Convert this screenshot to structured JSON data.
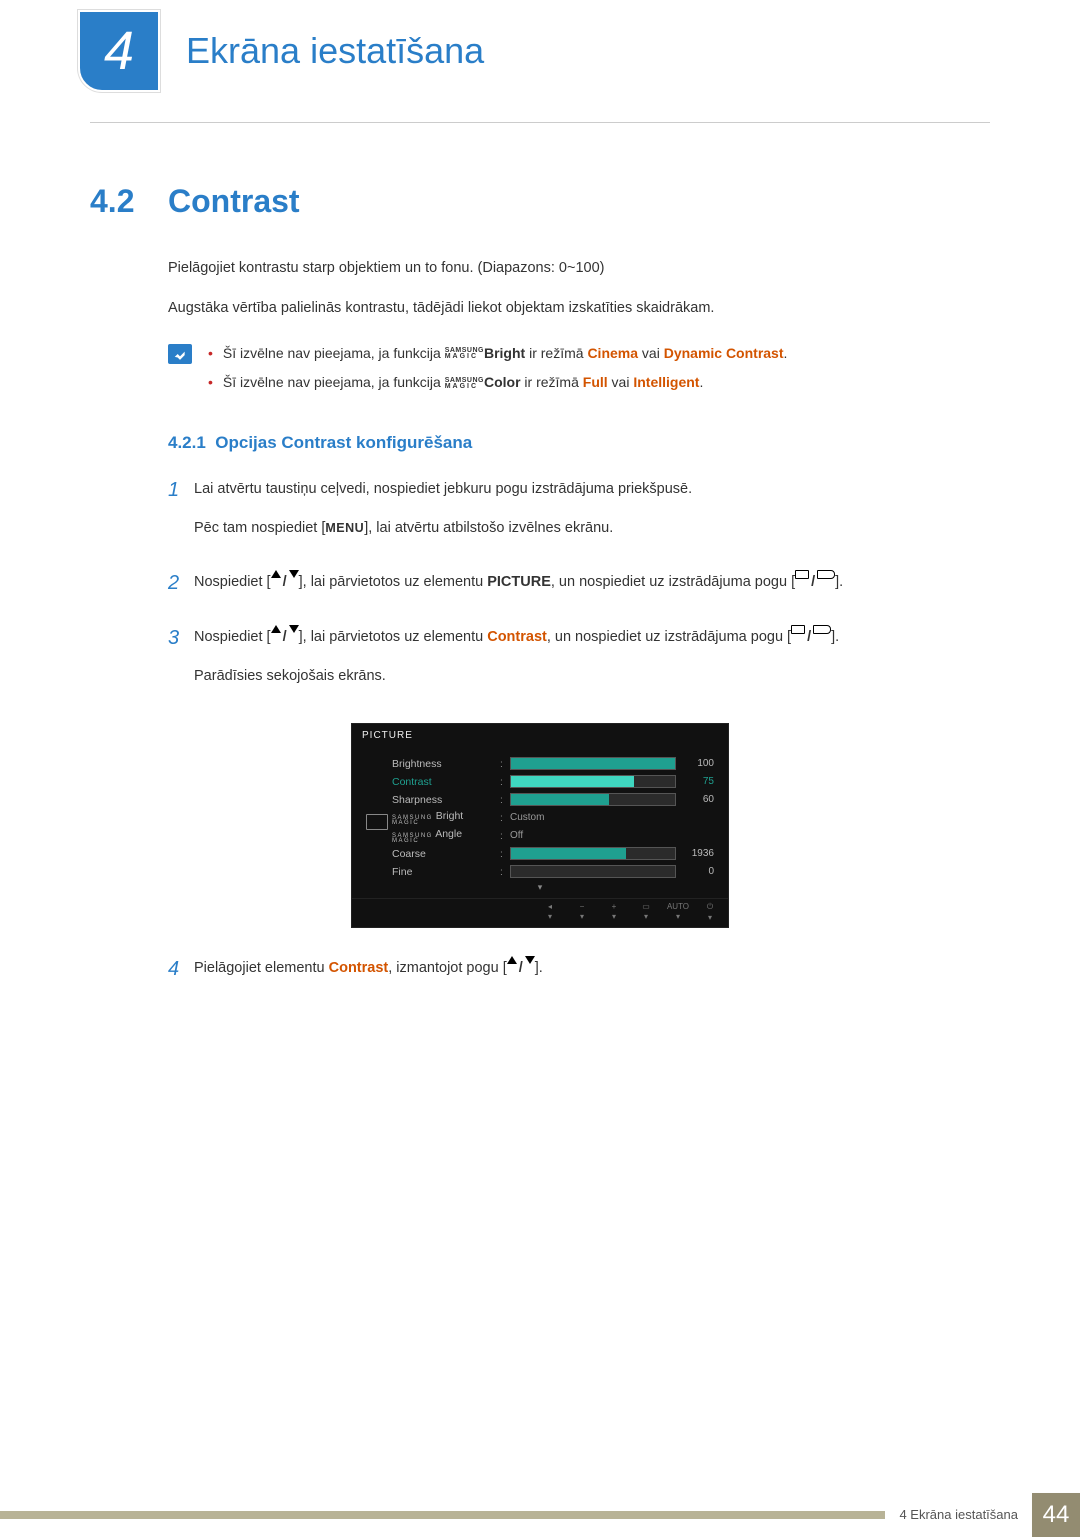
{
  "header": {
    "chapter_number": "4",
    "chapter_title": "Ekrāna iestatīšana"
  },
  "section": {
    "number": "4.2",
    "title": "Contrast"
  },
  "intro": {
    "p1": "Pielāgojiet kontrastu starp objektiem un to fonu. (Diapazons: 0~100)",
    "p2": "Augstāka vērtība palielinās kontrastu, tādējādi liekot objektam izskatīties skaidrākam."
  },
  "notes": {
    "n1_a": "Šī izvēlne nav pieejama, ja funkcija ",
    "n1_bold": "Bright",
    "n1_mid": " ir režīmā ",
    "n1_o1": "Cinema",
    "n1_or": " vai ",
    "n1_o2": "Dynamic Contrast",
    "n2_a": "Šī izvēlne nav pieejama, ja funkcija ",
    "n2_bold": "Color",
    "n2_mid": " ir režīmā ",
    "n2_o1": "Full",
    "n2_or": " vai ",
    "n2_o2": "Intelligent",
    "magic_top": "SAMSUNG",
    "magic_bot": "MAGIC",
    "dot": "."
  },
  "subheading": {
    "number": "4.2.1",
    "title": "Opcijas Contrast konfigurēšana"
  },
  "steps": {
    "s1": {
      "num": "1",
      "line1": "Lai atvērtu taustiņu ceļvedi, nospiediet jebkuru pogu izstrādājuma priekšpusē.",
      "line2a": "Pēc tam nospiediet [",
      "menu": "MENU",
      "line2b": "], lai atvērtu atbilstošo izvēlnes ekrānu."
    },
    "s2": {
      "num": "2",
      "a": "Nospiediet [",
      "b": "], lai pārvietotos uz elementu ",
      "pict": "PICTURE",
      "c": ", un nospiediet uz izstrādājuma pogu [",
      "d": "]."
    },
    "s3": {
      "num": "3",
      "a": "Nospiediet [",
      "b": "], lai pārvietotos uz elementu ",
      "con": "Contrast",
      "c": ", un nospiediet uz izstrādājuma pogu [",
      "d": "].",
      "after": "Parādīsies sekojošais ekrāns."
    },
    "s4": {
      "num": "4",
      "a": "Pielāgojiet elementu ",
      "con": "Contrast",
      "b": ", izmantojot pogu [",
      "c": "]."
    }
  },
  "osd": {
    "title": "PICTURE",
    "rows": {
      "brightness": {
        "label": "Brightness",
        "value": "100",
        "fill": 100
      },
      "contrast": {
        "label": "Contrast",
        "value": "75",
        "fill": 75,
        "active": true
      },
      "sharpness": {
        "label": "Sharpness",
        "value": "60",
        "fill": 60
      },
      "magic_bright": {
        "label": "Bright",
        "value": "Custom"
      },
      "magic_angle": {
        "label": "Angle",
        "value": "Off"
      },
      "coarse": {
        "label": "Coarse",
        "value": "1936",
        "fill": 70
      },
      "fine": {
        "label": "Fine",
        "value": "0",
        "fill": 0
      }
    },
    "footer_auto": "AUTO"
  },
  "footer": {
    "label": "4 Ekrāna iestatīšana",
    "page": "44"
  }
}
